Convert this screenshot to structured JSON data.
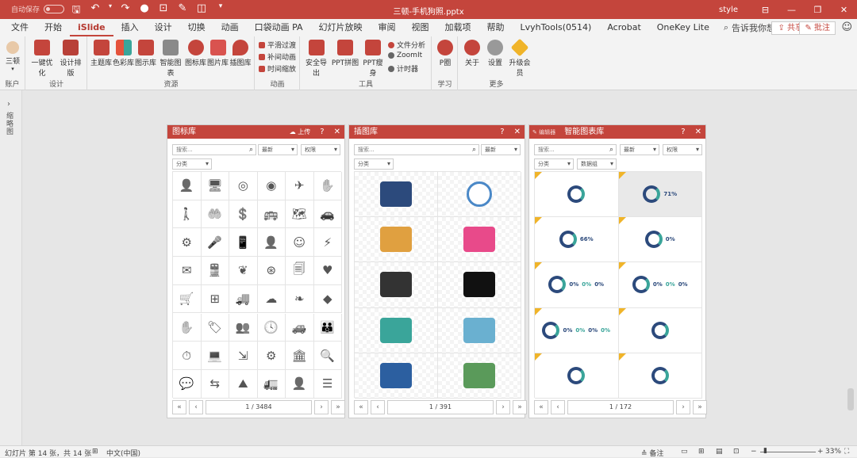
{
  "titlebar": {
    "autosave_label": "自动保存",
    "autosave_state": "关",
    "doc_title": "三顿-手机狗照.pptx",
    "user": "style",
    "qat_icons": [
      "save-icon",
      "undo-icon",
      "redo-icon",
      "record-icon",
      "screenshot-icon",
      "pen-icon",
      "eraser-icon",
      "dropdown-icon"
    ]
  },
  "tabs": [
    "文件",
    "开始",
    "iSlide",
    "插入",
    "设计",
    "切换",
    "动画",
    "口袋动画 PA",
    "幻灯片放映",
    "审阅",
    "视图",
    "加载项",
    "帮助",
    "LvyhTools(0514)",
    "Acrobat",
    "OneKey Lite"
  ],
  "active_tab": "iSlide",
  "tell_me": "告诉我你想要做什么",
  "share_label": "共享",
  "comment_label": "批注",
  "ribbon": {
    "account": {
      "button": "三顿",
      "group": "账户"
    },
    "design": {
      "buttons": [
        "一键优化",
        "设计排版"
      ],
      "group": "设计"
    },
    "resources": {
      "buttons": [
        "主题库",
        "色彩库",
        "图示库",
        "智能图表",
        "图标库",
        "图片库",
        "插图库"
      ],
      "group": "资源"
    },
    "animation": {
      "buttons": [
        "平滑过渡",
        "补间动画",
        "时间缩放"
      ],
      "group": "动画"
    },
    "tools": {
      "buttons": [
        "安全导出",
        "PPT拼图",
        "PPT瘦身"
      ],
      "small": [
        "文件分析",
        "ZoomIt",
        "计时器"
      ],
      "group": "工具"
    },
    "learn": {
      "buttons": [
        "P圈"
      ],
      "group": "学习"
    },
    "more": {
      "buttons": [
        "关于",
        "设置",
        "升级会员"
      ],
      "group": "更多"
    }
  },
  "left_rail": {
    "label": "缩略图"
  },
  "panels": [
    {
      "title": "图标库",
      "upload": "上传",
      "search_placeholder": "搜索...",
      "sort": "最新",
      "rights": "权限",
      "category": "分类",
      "page": "1 / 3484",
      "icons": [
        "user-shield",
        "monitor-network",
        "target-arrow",
        "bullseye",
        "airplane",
        "hand-money",
        "person-pointing",
        "hand-heart",
        "hand-dollar",
        "bus",
        "map-person",
        "car-front",
        "brain-gear",
        "microphone",
        "phone-money",
        "person-money",
        "person-circle",
        "lightning",
        "letter-gear",
        "train",
        "kidneys",
        "coin-circle",
        "document-stack",
        "heart",
        "cart-money",
        "windows-logo",
        "truck-parking",
        "cloud-chat",
        "leaf-globe",
        "apple-logo",
        "hand-money-2",
        "tag-dollar",
        "people-group",
        "clock",
        "car-side",
        "team",
        "stopwatch",
        "laptop-chart",
        "steps",
        "head-gear",
        "bank",
        "search-dollar",
        "chat-bubbles",
        "signpost",
        "mountain-flag",
        "truck-box",
        "person-badge",
        "checklist"
      ]
    },
    {
      "title": "插图库",
      "search_placeholder": "搜索...",
      "sort": "最新",
      "category": "分类",
      "page": "1 / 391",
      "illustrations": [
        "presentation-board",
        "wall-clock",
        "business-handshake",
        "laptop-desk",
        "desk-worker",
        "crowd-silhouette",
        "books-stack",
        "clipboard-checklist",
        "blue-mountain",
        "money-people"
      ]
    },
    {
      "title": "智能图表库",
      "badge": "编辑器",
      "search_placeholder": "搜索...",
      "sort": "最新",
      "rights": "权限",
      "category": "分类",
      "data_group": "数据组",
      "page": "1 / 172",
      "thumbs": [
        {
          "labels": []
        },
        {
          "labels": [
            "71%"
          ]
        },
        {
          "labels": [
            "66%"
          ]
        },
        {
          "labels": [
            "0%"
          ]
        },
        {
          "labels": [
            "0%",
            "0%",
            "0%"
          ]
        },
        {
          "labels": [
            "0%",
            "0%",
            "0%"
          ]
        },
        {
          "labels": [
            "0%",
            "0%",
            "0%",
            "0%"
          ]
        },
        {
          "labels": []
        },
        {
          "labels": []
        },
        {
          "labels": []
        }
      ]
    }
  ],
  "status": {
    "slide_info": "幻灯片 第 14 张，共 14 张",
    "language": "中文(中国)",
    "notes": "备注",
    "zoom": "33%"
  },
  "colors": {
    "accent": "#c4453c",
    "teal": "#3aa59a",
    "navy": "#2c4a7c"
  }
}
